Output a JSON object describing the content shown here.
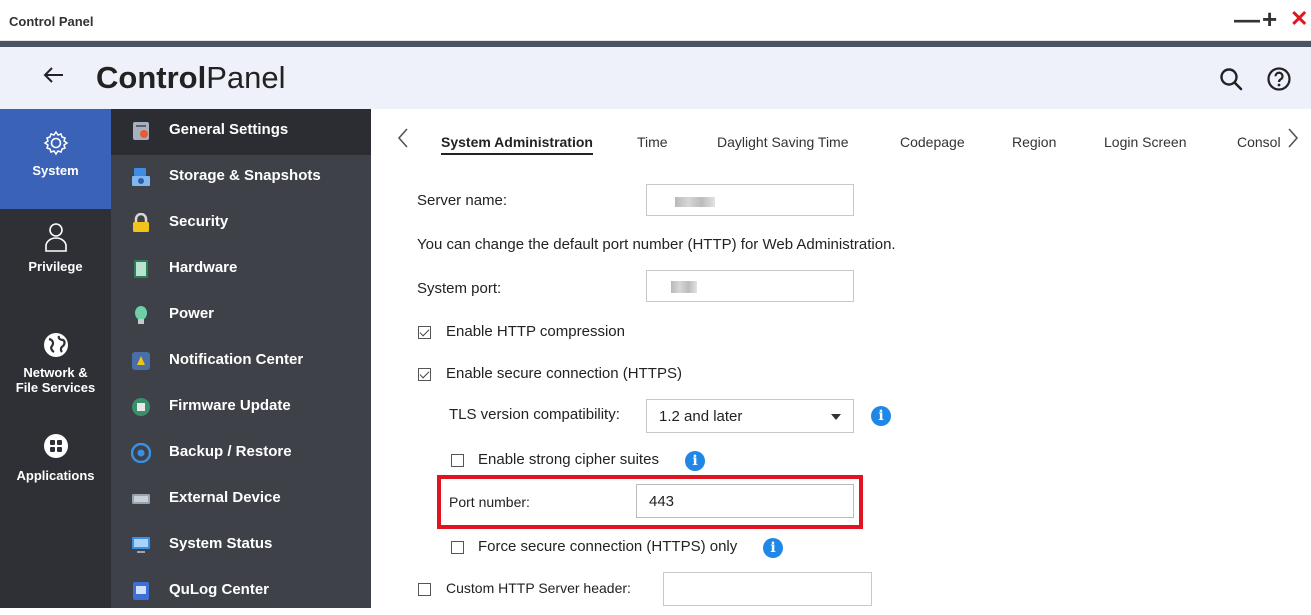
{
  "window": {
    "title": "Control Panel",
    "controls": {
      "minimize": "—",
      "maximize": "+",
      "close": "✕"
    }
  },
  "header": {
    "back_icon": "arrow-left-icon",
    "title_bold": "Control",
    "title_rest": "Panel",
    "icons": [
      "search-icon",
      "help-icon"
    ]
  },
  "left_nav": [
    {
      "label": "System",
      "icon": "gear-icon",
      "active": true
    },
    {
      "label": "Privilege",
      "icon": "user-icon",
      "active": false
    },
    {
      "label": "Network &\nFile Services",
      "label_line1": "Network &",
      "label_line2": "File Services",
      "icon": "globe-icon",
      "active": false
    },
    {
      "label": "Applications",
      "icon": "grid-icon",
      "active": false
    }
  ],
  "sub_nav": [
    {
      "label": "General Settings",
      "icon": "settings-icon",
      "active": true
    },
    {
      "label": "Storage & Snapshots",
      "icon": "storage-icon"
    },
    {
      "label": "Security",
      "icon": "lock-icon"
    },
    {
      "label": "Hardware",
      "icon": "hardware-icon"
    },
    {
      "label": "Power",
      "icon": "power-icon"
    },
    {
      "label": "Notification Center",
      "icon": "notification-icon"
    },
    {
      "label": "Firmware Update",
      "icon": "firmware-icon"
    },
    {
      "label": "Backup / Restore",
      "icon": "backup-icon"
    },
    {
      "label": "External Device",
      "icon": "external-device-icon"
    },
    {
      "label": "System Status",
      "icon": "monitor-icon"
    },
    {
      "label": "QuLog Center",
      "icon": "log-icon"
    }
  ],
  "tabs": [
    {
      "label": "System Administration",
      "active": true
    },
    {
      "label": "Time"
    },
    {
      "label": "Daylight Saving Time"
    },
    {
      "label": "Codepage"
    },
    {
      "label": "Region"
    },
    {
      "label": "Login Screen"
    },
    {
      "label": "Consol"
    }
  ],
  "form": {
    "server_name_label": "Server name:",
    "port_hint": "You can change the default port number (HTTP) for Web Administration.",
    "system_port_label": "System port:",
    "http_compression": {
      "label": "Enable HTTP compression",
      "checked": true
    },
    "https": {
      "label": "Enable secure connection (HTTPS)",
      "checked": true
    },
    "tls_label": "TLS version compatibility:",
    "tls_value": "1.2 and later",
    "strong_cipher": {
      "label": "Enable strong cipher suites",
      "checked": false
    },
    "port_number_label": "Port number:",
    "port_number_value": "443",
    "force_https": {
      "label": "Force secure connection (HTTPS) only",
      "checked": false
    },
    "custom_header": {
      "label": "Custom HTTP Server header:",
      "checked": false
    }
  },
  "colors": {
    "accent": "#3a63b7",
    "info": "#1f87e6",
    "highlight": "#e0141e",
    "nav_bg": "#2e3035",
    "subnav_bg": "#3e4147"
  }
}
